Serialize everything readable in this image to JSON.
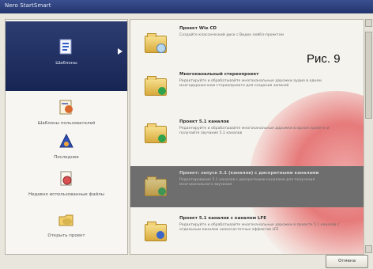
{
  "window": {
    "title": "Nero StartSmart"
  },
  "sidebar": {
    "items": [
      {
        "label": "Шаблоны",
        "icon": "document-icon",
        "selected": true
      },
      {
        "label": "Шаблоны пользователей",
        "icon": "user-templates-icon"
      },
      {
        "label": "Последнее",
        "icon": "recent-icon"
      },
      {
        "label": "Недавно использованные файлы",
        "icon": "recent-files-icon"
      },
      {
        "label": "Открыть проект",
        "icon": "open-project-icon"
      }
    ]
  },
  "projects": [
    {
      "title": "Проект Wie CD",
      "desc": "Создайте классический диск с Видео лейбл-проектом"
    },
    {
      "title": "Многоканальный стереопроект",
      "desc": "Редактируйте и обрабатывайте многоканальные дорожки аудио в одном многодорожечном стереопроекте для создания записей"
    },
    {
      "title": "Проект 5.1 каналов",
      "desc": "Редактируйте и обрабатывайте многоканальные дорожки в одном проекте и получайте звучание 5.1 каналов"
    },
    {
      "title": "Проект: запуск 5.1 (каналов) с дискретными каналами",
      "desc": "Редактирование 5.1 каналов с дискретными каналами для получения многоканального звучания",
      "selected": true
    },
    {
      "title": "Проект 5.1 каналов с каналом LFE",
      "desc": "Редактируйте и обрабатывайте многоканальные дорожки в проекте 5.1 каналов с отдельным каналом низкочастотных эффектов LFE"
    }
  ],
  "figure_label": "Рис. 9",
  "buttons": {
    "cancel": "Отмена"
  }
}
